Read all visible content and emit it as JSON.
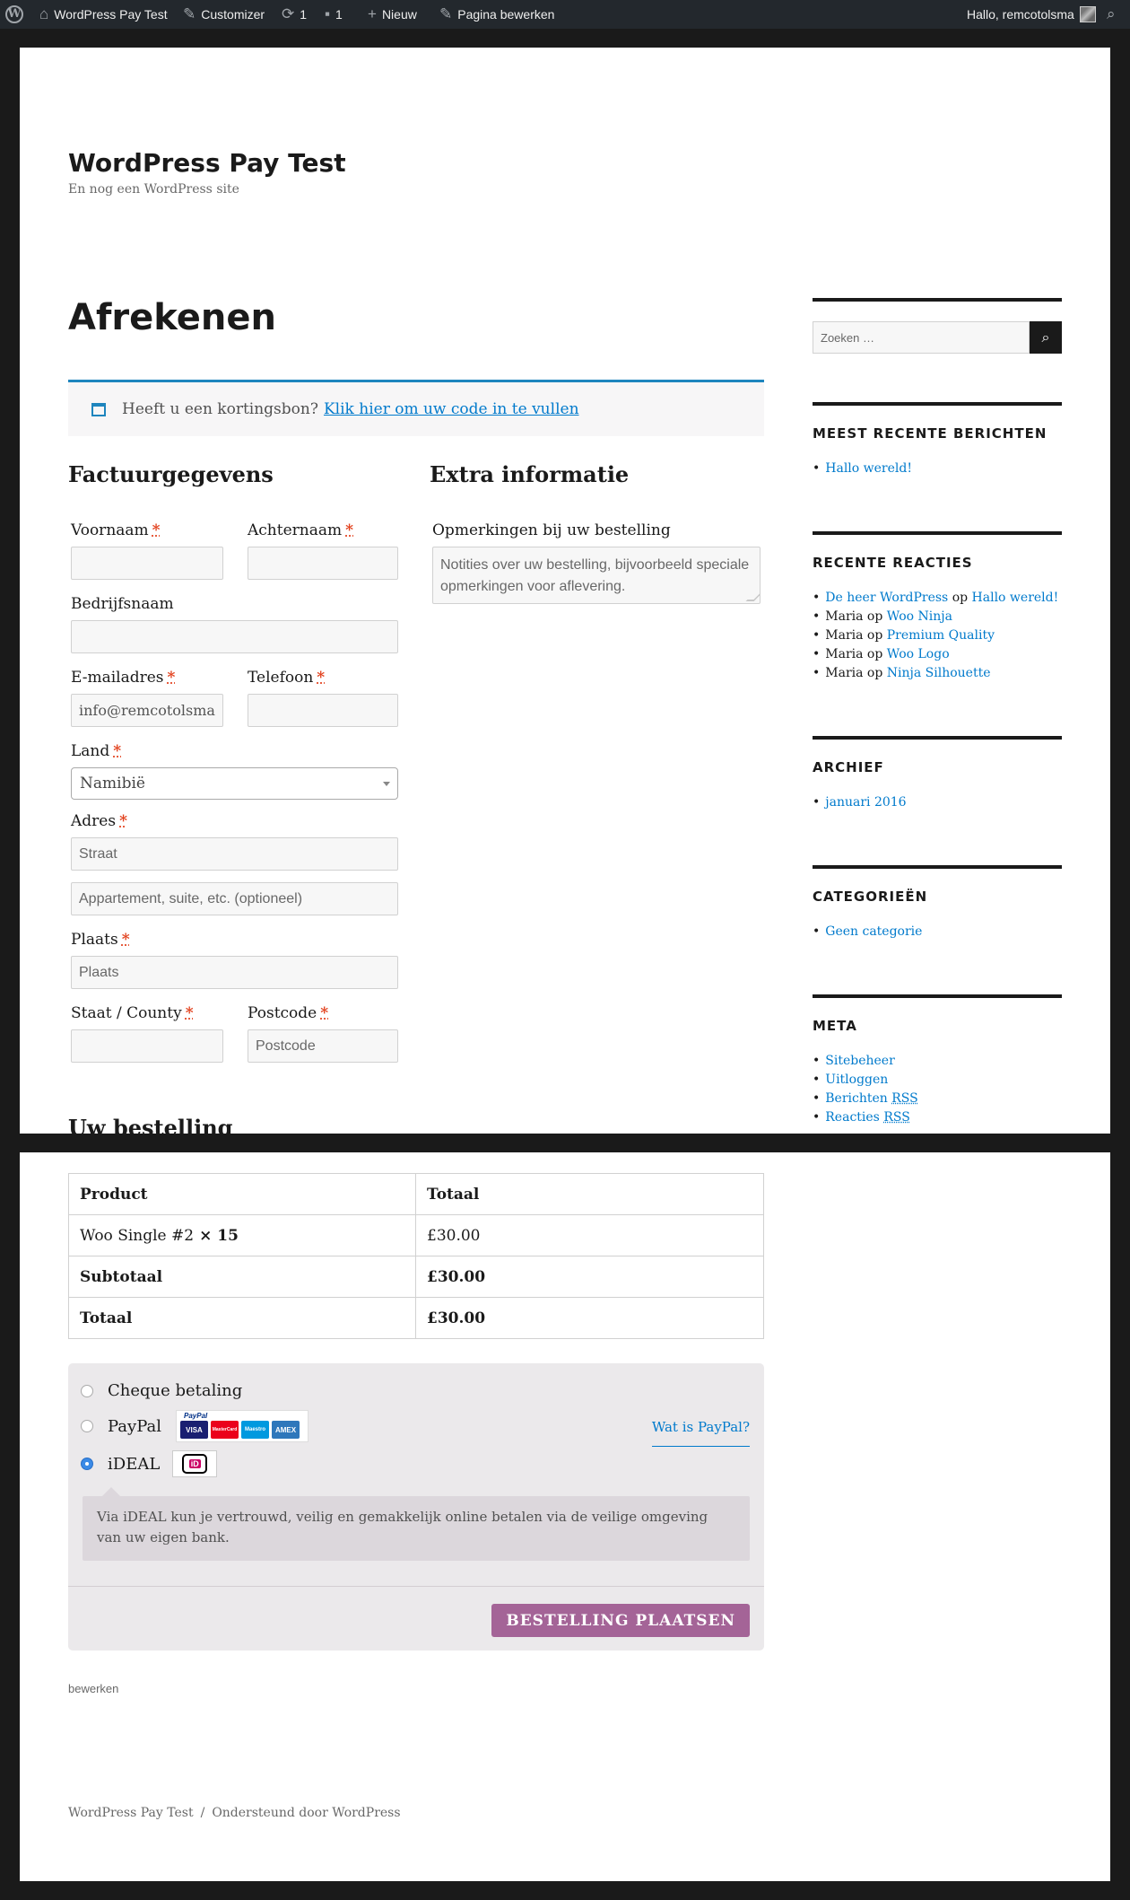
{
  "adminbar": {
    "site_name": "WordPress Pay Test",
    "customizer": "Customizer",
    "updates_count": "1",
    "comments_count": "1",
    "new": "Nieuw",
    "edit_page": "Pagina bewerken",
    "greeting": "Hallo, remcotolsma"
  },
  "site": {
    "title": "WordPress Pay Test",
    "description": "En nog een WordPress site"
  },
  "page_title": "Afrekenen",
  "coupon": {
    "text": "Heeft u een kortingsbon?",
    "link": "Klik hier om uw code in te vullen"
  },
  "billing": {
    "heading": "Factuurgegevens",
    "required_mark": "*",
    "first_name_label": "Voornaam",
    "last_name_label": "Achternaam",
    "company_label": "Bedrijfsnaam",
    "email_label": "E-mailadres",
    "email_value": "info@remcotolsma",
    "phone_label": "Telefoon",
    "country_label": "Land",
    "country_value": "Namibië",
    "address_label": "Adres",
    "address1_placeholder": "Straat",
    "address2_placeholder": "Appartement, suite, etc. (optioneel)",
    "city_label": "Plaats",
    "city_placeholder": "Plaats",
    "state_label": "Staat / County",
    "postcode_label": "Postcode",
    "postcode_placeholder": "Postcode"
  },
  "extra": {
    "heading": "Extra informatie",
    "notes_label": "Opmerkingen bij uw bestelling",
    "notes_placeholder": "Notities over uw bestelling, bijvoorbeeld speciale opmerkingen voor aflevering."
  },
  "order_heading": "Uw bestelling",
  "sidebar": {
    "search_placeholder": "Zoeken …",
    "recent_posts": {
      "title": "MEEST RECENTE BERICHTEN",
      "items": [
        "Hallo wereld!"
      ]
    },
    "recent_comments": {
      "title": "RECENTE REACTIES",
      "connector": "op",
      "items": [
        {
          "author": "De heer WordPress",
          "post": "Hallo wereld!"
        },
        {
          "author": "Maria",
          "post": "Woo Ninja"
        },
        {
          "author": "Maria",
          "post": "Premium Quality"
        },
        {
          "author": "Maria",
          "post": "Woo Logo"
        },
        {
          "author": "Maria",
          "post": "Ninja Silhouette"
        }
      ]
    },
    "archive": {
      "title": "ARCHIEF",
      "items": [
        "januari 2016"
      ]
    },
    "categories": {
      "title": "CATEGORIEËN",
      "items": [
        "Geen categorie"
      ]
    },
    "meta": {
      "title": "META",
      "items": [
        "Sitebeheer",
        "Uitloggen",
        "Berichten",
        "Reacties"
      ],
      "rss": "RSS"
    }
  },
  "order_table": {
    "col_product": "Product",
    "col_total": "Totaal",
    "item_name": "Woo Single #2",
    "item_qty": "× 15",
    "item_total": "£30.00",
    "subtotal_label": "Subtotaal",
    "subtotal_value": "£30.00",
    "total_label": "Totaal",
    "total_value": "£30.00"
  },
  "payment": {
    "cheque": "Cheque betaling",
    "paypal": "PayPal",
    "paypal_logo_text": "PayPal",
    "card_visa": "VISA",
    "card_mc": "MasterCard",
    "card_maestro": "Maestro",
    "card_amex": "AMEX",
    "paypal_link": "Wat is PayPal?",
    "ideal": "iDEAL",
    "ideal_logo_text": "iD",
    "ideal_description": "Via iDEAL kun je vertrouwd, veilig en gemakkelijk online betalen via de veilige omgeving van uw eigen bank.",
    "place_order": "BESTELLING PLAATSEN"
  },
  "edit_link": "bewerken",
  "footer": {
    "site": "WordPress Pay Test",
    "separator": "/",
    "powered": "Ondersteund door WordPress"
  },
  "colors": {
    "admin_bar": "#23282d",
    "link": "#007acc",
    "info_border": "#1e85be",
    "required": "#e2401c",
    "button": "#a46497",
    "radio_selected": "#3b8ae6"
  }
}
